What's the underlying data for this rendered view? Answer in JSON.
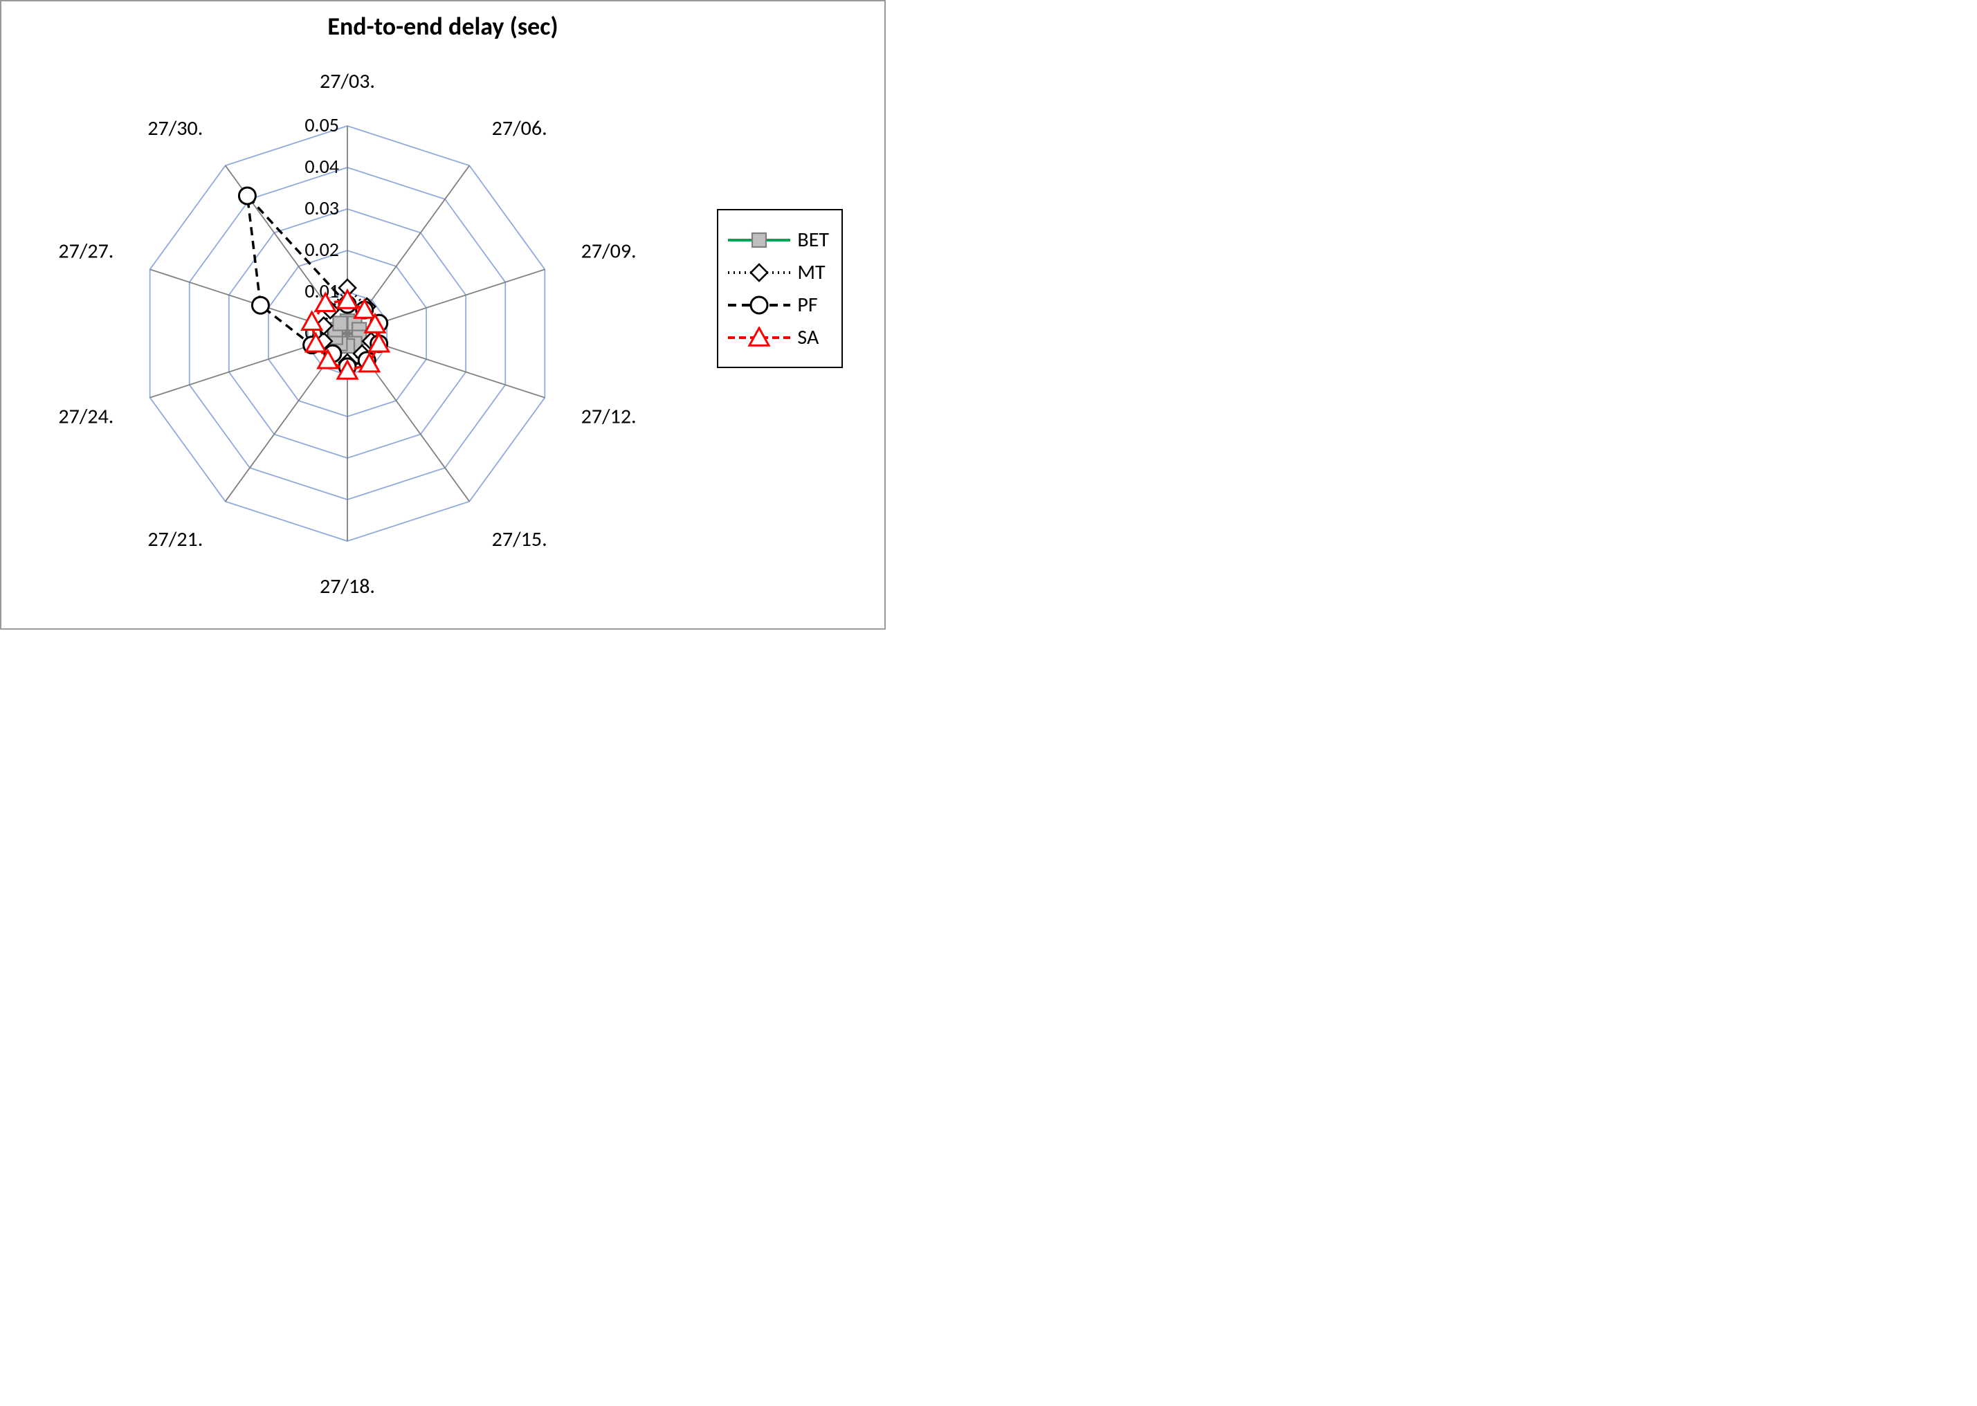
{
  "chart_data": {
    "type": "radar",
    "title": "End-to-end delay (sec)",
    "categories": [
      "27/03.",
      "27/06.",
      "27/09.",
      "27/12.",
      "27/15.",
      "27/18.",
      "27/21.",
      "27/24.",
      "27/27.",
      "27/30."
    ],
    "rings": [
      0.0,
      0.01,
      0.02,
      0.03,
      0.04,
      0.05
    ],
    "max": 0.05,
    "series": [
      {
        "name": "BET",
        "values": [
          0.003,
          0.003,
          0.003,
          0.003,
          0.003,
          0.003,
          0.003,
          0.003,
          0.003,
          0.003
        ],
        "line_color": "#00a651",
        "line_dash": null,
        "marker": "square",
        "marker_color": "#bfbfbf"
      },
      {
        "name": "MT",
        "values": [
          0.011,
          0.008,
          0.008,
          0.006,
          0.006,
          0.007,
          0.006,
          0.006,
          0.006,
          0.007
        ],
        "line_color": "#000000",
        "line_dash": "2,6",
        "marker": "diamond",
        "marker_color": "#ffffff"
      },
      {
        "name": "PF",
        "values": [
          0.007,
          0.007,
          0.008,
          0.008,
          0.008,
          0.008,
          0.006,
          0.009,
          0.022,
          0.041
        ],
        "line_color": "#000000",
        "line_dash": "12,8",
        "marker": "circle",
        "marker_color": "#ffffff"
      },
      {
        "name": "SA",
        "values": [
          0.008,
          0.007,
          0.007,
          0.008,
          0.009,
          0.009,
          0.008,
          0.008,
          0.009,
          0.009
        ],
        "line_color": "#ff0000",
        "line_dash": "10,6",
        "marker": "triangle",
        "marker_color": "#ffffff"
      }
    ],
    "grid_color": "#8faadc",
    "axis_color": "#808080"
  }
}
